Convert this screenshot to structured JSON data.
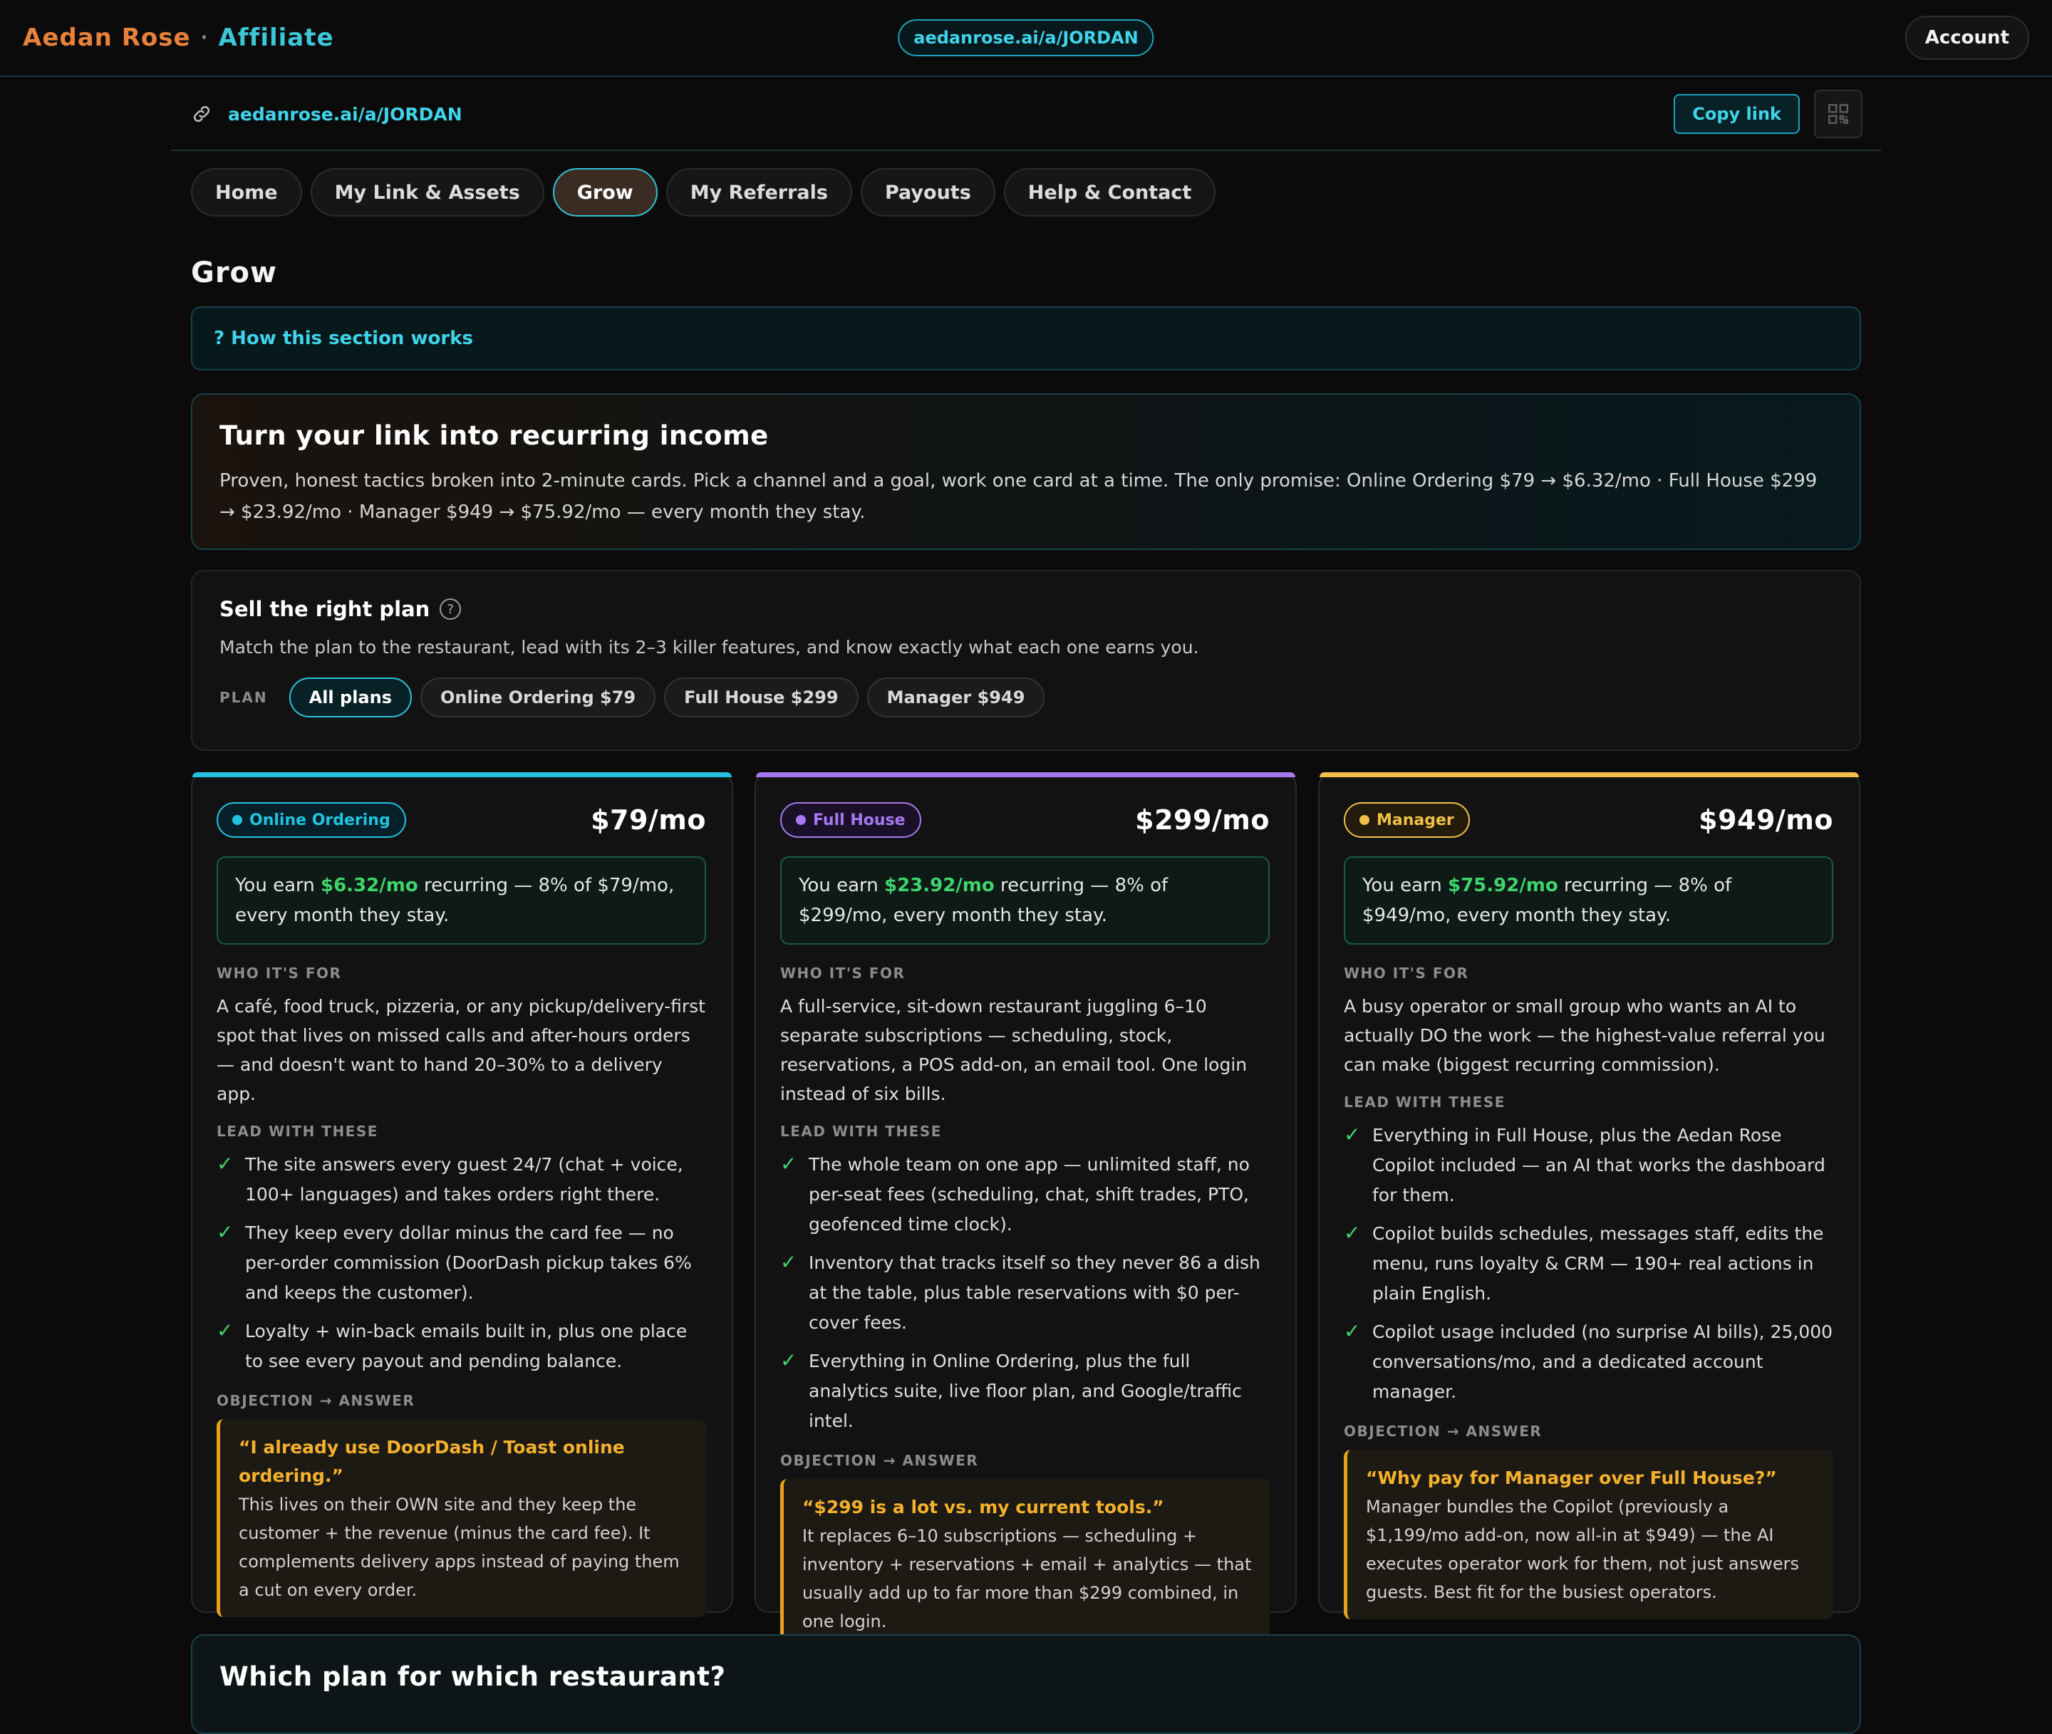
{
  "brand": {
    "name": "Aedan Rose",
    "separator": "·",
    "section": "Affiliate"
  },
  "header": {
    "link_pill": "aedanrose.ai/a/JORDAN",
    "account_label": "Account"
  },
  "link_row": {
    "link": "aedanrose.ai/a/JORDAN",
    "copy_label": "Copy link"
  },
  "tabs": [
    {
      "label": "Home"
    },
    {
      "label": "My Link & Assets"
    },
    {
      "label": "Grow",
      "active": true
    },
    {
      "label": "My Referrals"
    },
    {
      "label": "Payouts"
    },
    {
      "label": "Help & Contact"
    }
  ],
  "page": {
    "title": "Grow",
    "howto": "? How this section works"
  },
  "hero": {
    "title": "Turn your link into recurring income",
    "text": "Proven, honest tactics broken into 2-minute cards. Pick a channel and a goal, work one card at a time. The only promise: Online Ordering $79 → $6.32/mo · Full House $299 → $23.92/mo · Manager $949 → $75.92/mo — every month they stay."
  },
  "sell": {
    "title": "Sell the right plan",
    "help_icon": "?",
    "subtitle": "Match the plan to the restaurant, lead with its 2–3 killer features, and know exactly what each one earns you.",
    "plan_label": "PLAN",
    "chips": [
      {
        "label": "All plans",
        "active": true
      },
      {
        "label": "Online Ordering $79"
      },
      {
        "label": "Full House $299"
      },
      {
        "label": "Manager $949"
      }
    ]
  },
  "labels": {
    "who": "WHO IT'S FOR",
    "lead": "LEAD WITH THESE",
    "objection": "OBJECTION → ANSWER"
  },
  "plans": [
    {
      "badge": "Online Ordering",
      "price": "$79/mo",
      "accent": "#22c3e0",
      "earn_prefix": "You earn ",
      "earn_amount": "$6.32/mo",
      "earn_suffix": " recurring — 8% of $79/mo, every month they stay.",
      "who": "A café, food truck, pizzeria, or any pickup/delivery-first spot that lives on missed calls and after-hours orders — and doesn't want to hand 20–30% to a delivery app.",
      "lead": [
        "The site answers every guest 24/7 (chat + voice, 100+ languages) and takes orders right there.",
        "They keep every dollar minus the card fee — no per-order commission (DoorDash pickup takes 6% and keeps the customer).",
        "Loyalty + win-back emails built in, plus one place to see every payout and pending balance."
      ],
      "objection_q": "“I already use DoorDash / Toast online ordering.”",
      "objection_a": "This lives on their OWN site and they keep the customer + the revenue (minus the card fee). It complements delivery apps instead of paying them a cut on every order."
    },
    {
      "badge": "Full House",
      "price": "$299/mo",
      "accent": "#a779f0",
      "earn_prefix": "You earn ",
      "earn_amount": "$23.92/mo",
      "earn_suffix": " recurring — 8% of $299/mo, every month they stay.",
      "who": "A full-service, sit-down restaurant juggling 6–10 separate subscriptions — scheduling, stock, reservations, a POS add-on, an email tool. One login instead of six bills.",
      "lead": [
        "The whole team on one app — unlimited staff, no per-seat fees (scheduling, chat, shift trades, PTO, geofenced time clock).",
        "Inventory that tracks itself so they never 86 a dish at the table, plus table reservations with $0 per-cover fees.",
        "Everything in Online Ordering, plus the full analytics suite, live floor plan, and Google/traffic intel."
      ],
      "objection_q": "“$299 is a lot vs. my current tools.”",
      "objection_a": "It replaces 6–10 subscriptions — scheduling + inventory + reservations + email + analytics — that usually add up to far more than $299 combined, in one login."
    },
    {
      "badge": "Manager",
      "price": "$949/mo",
      "accent": "#f2c04a",
      "earn_prefix": "You earn ",
      "earn_amount": "$75.92/mo",
      "earn_suffix": " recurring — 8% of $949/mo, every month they stay.",
      "who": "A busy operator or small group who wants an AI to actually DO the work — the highest-value referral you can make (biggest recurring commission).",
      "lead": [
        "Everything in Full House, plus the Aedan Rose Copilot included — an AI that works the dashboard for them.",
        "Copilot builds schedules, messages staff, edits the menu, runs loyalty & CRM — 190+ real actions in plain English.",
        "Copilot usage included (no surprise AI bills), 25,000 conversations/mo, and a dedicated account manager."
      ],
      "objection_q": "“Why pay for Manager over Full House?”",
      "objection_a": "Manager bundles the Copilot (previously a $1,199/mo add-on, now all-in at $949) — the AI executes operator work for them, not just answers guests. Best fit for the busiest operators."
    }
  ],
  "which": {
    "title": "Which plan for which restaurant?"
  }
}
